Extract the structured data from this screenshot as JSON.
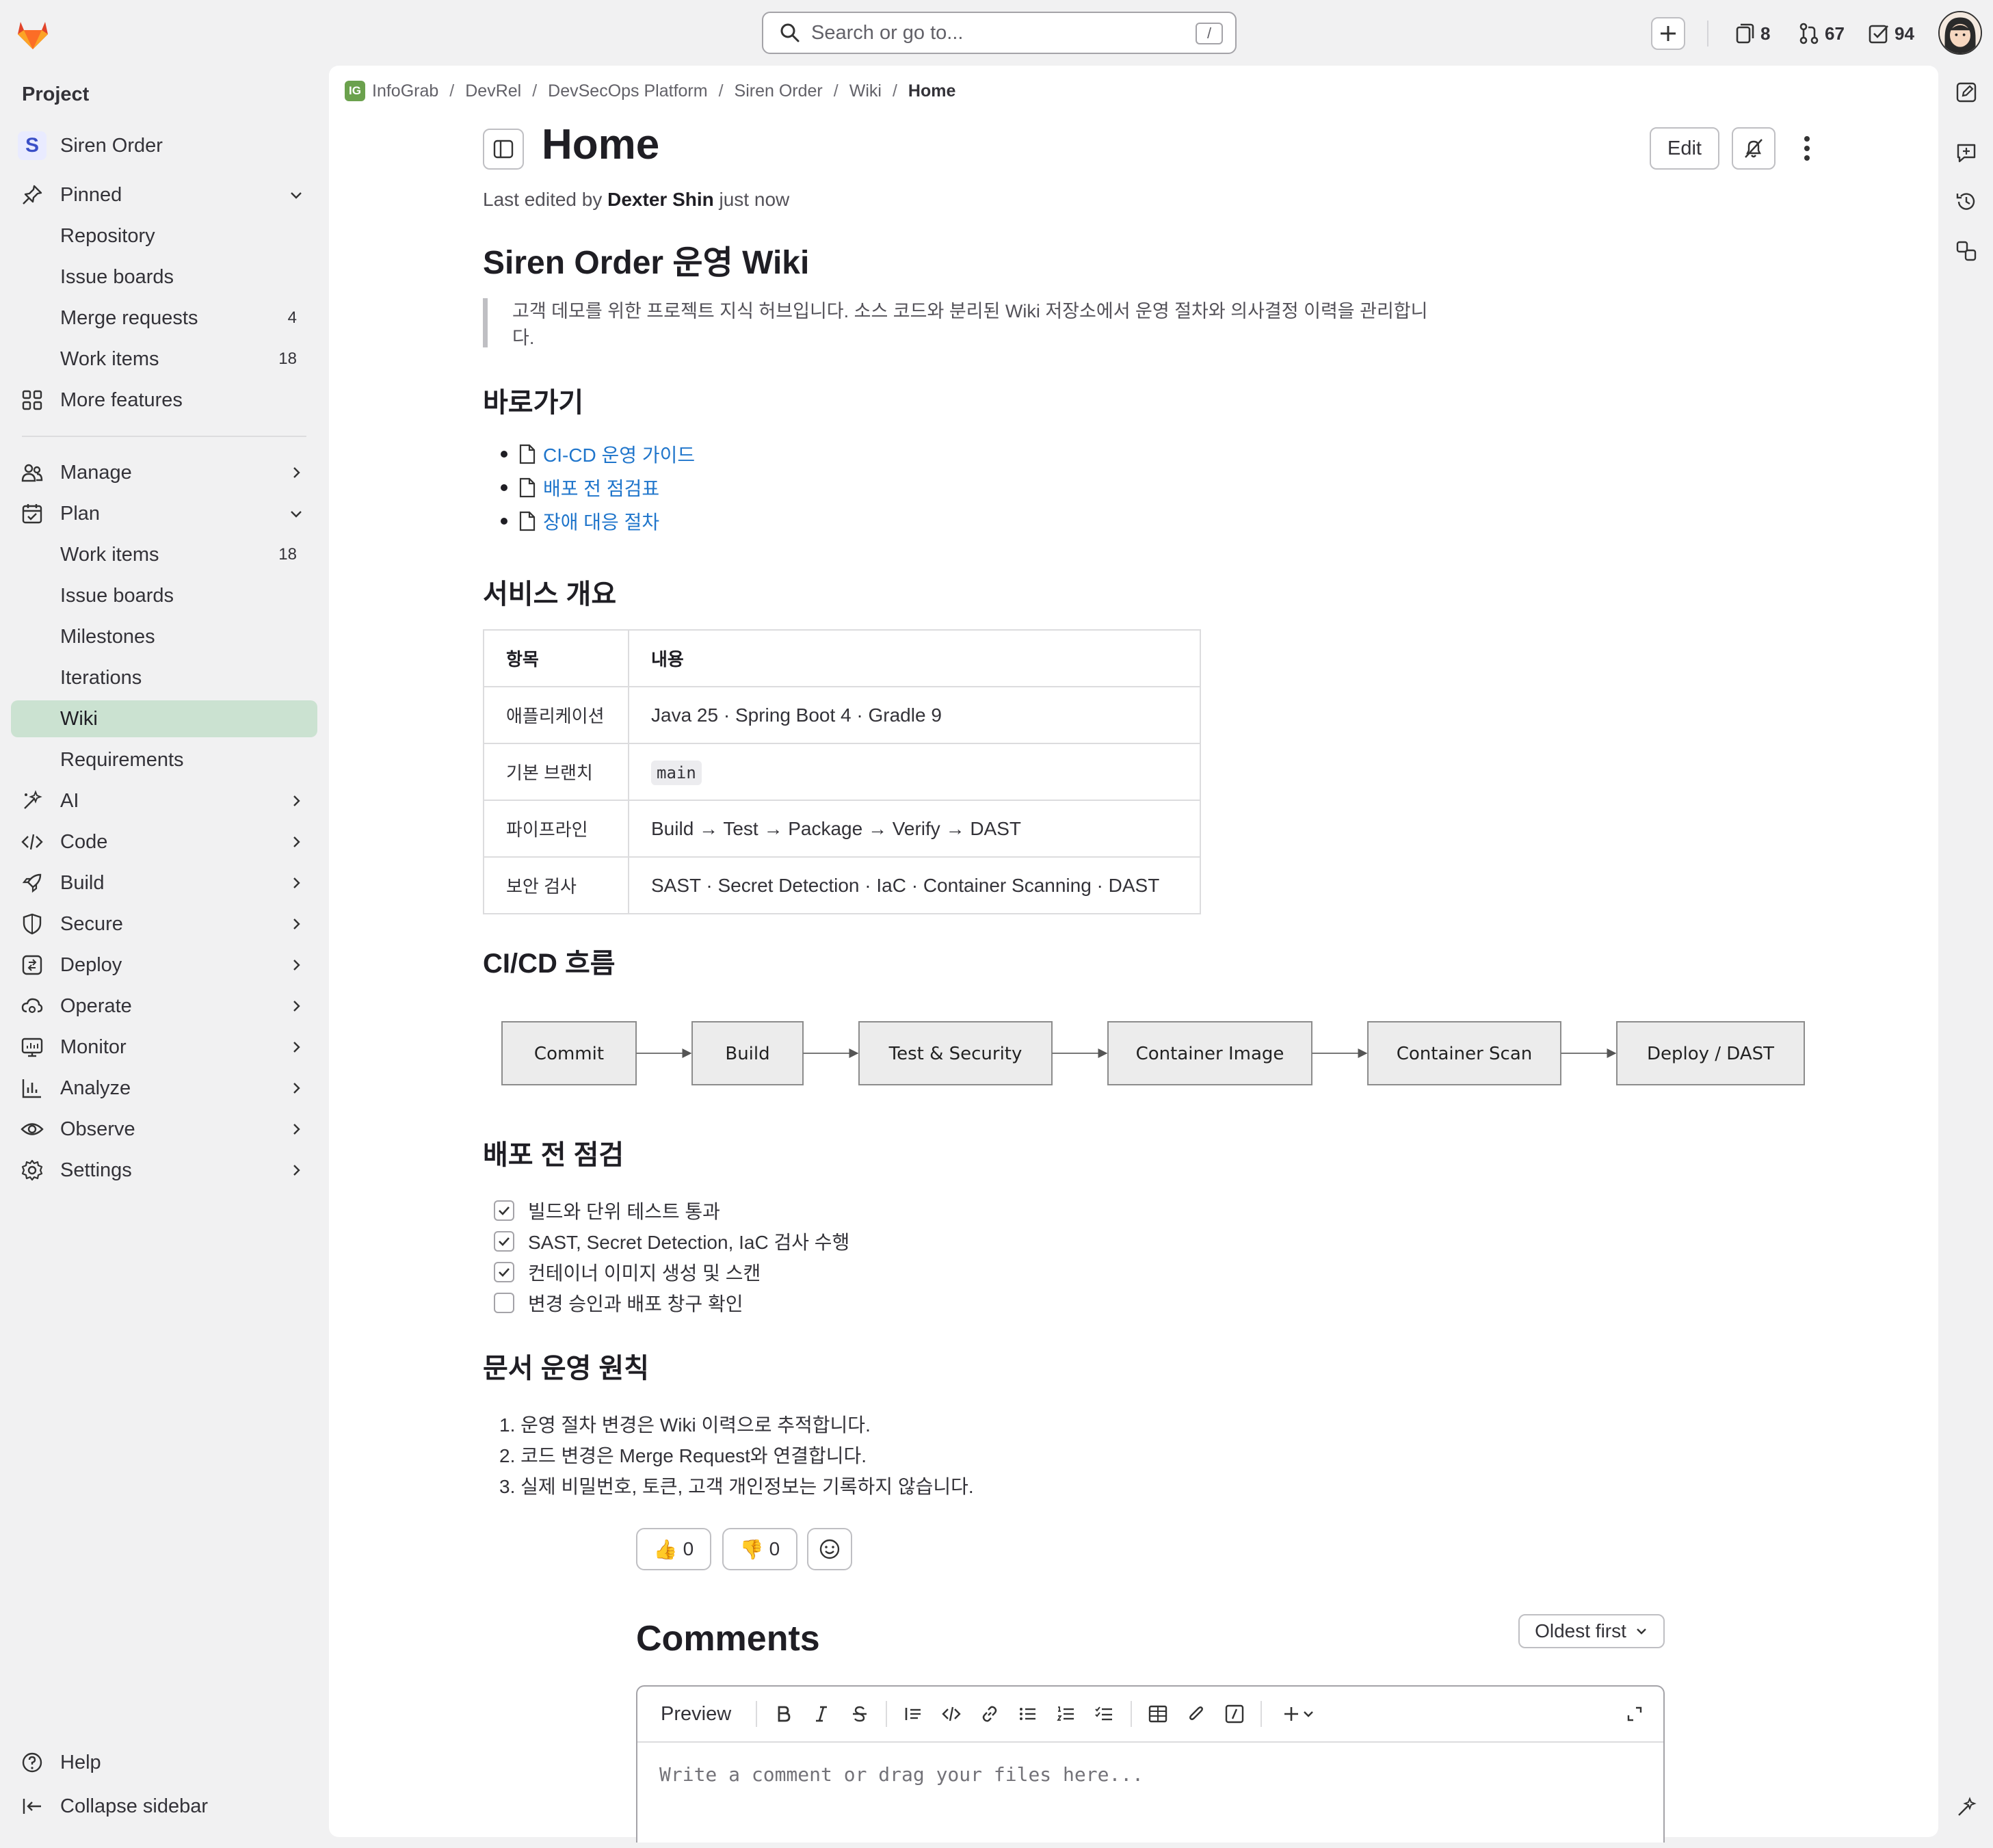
{
  "search": {
    "placeholder": "Search or go to...",
    "shortcut": "/"
  },
  "top_counters": {
    "issues": "8",
    "merge_requests": "67",
    "todos": "94"
  },
  "sidebar": {
    "heading": "Project",
    "project": {
      "badge": "S",
      "name": "Siren Order"
    },
    "pinned": {
      "label": "Pinned",
      "items": [
        {
          "label": "Repository",
          "count": ""
        },
        {
          "label": "Issue boards",
          "count": ""
        },
        {
          "label": "Merge requests",
          "count": "4"
        },
        {
          "label": "Work items",
          "count": "18"
        }
      ]
    },
    "more_features": "More features",
    "manage": "Manage",
    "plan": {
      "label": "Plan",
      "items": [
        {
          "label": "Work items",
          "count": "18"
        },
        {
          "label": "Issue boards",
          "count": ""
        },
        {
          "label": "Milestones",
          "count": ""
        },
        {
          "label": "Iterations",
          "count": ""
        },
        {
          "label": "Wiki",
          "count": ""
        },
        {
          "label": "Requirements",
          "count": ""
        }
      ]
    },
    "groups": [
      "AI",
      "Code",
      "Build",
      "Secure",
      "Deploy",
      "Operate",
      "Monitor",
      "Analyze",
      "Observe",
      "Settings"
    ],
    "help": "Help",
    "collapse": "Collapse sidebar"
  },
  "breadcrumbs": [
    "InfoGrab",
    "DevRel",
    "DevSecOps Platform",
    "Siren Order",
    "Wiki",
    "Home"
  ],
  "breadcrumb_badge": "IG",
  "page": {
    "title": "Home",
    "edit_label": "Edit",
    "last_edited_prefix": "Last edited by",
    "last_edited_author": "Dexter Shin",
    "last_edited_suffix": "just now"
  },
  "wiki": {
    "h1": "Siren Order 운영 Wiki",
    "quote": "고객 데모를 위한 프로젝트 지식 허브입니다. 소스 코드와 분리된 Wiki 저장소에서 운영 절차와 의사결정 이력을 관리합니다.",
    "shortcuts_heading": "바로가기",
    "shortcuts": [
      "CI-CD 운영 가이드",
      "배포 전 점검표",
      "장애 대응 절차"
    ],
    "service_heading": "서비스 개요",
    "table": {
      "headers": [
        "항목",
        "내용"
      ],
      "rows": [
        [
          "애플리케이션",
          "Java 25 · Spring Boot 4 · Gradle 9"
        ],
        [
          "기본 브랜치",
          "main"
        ],
        [
          "파이프라인",
          "Build → Test → Package → Verify → DAST"
        ],
        [
          "보안 검사",
          "SAST · Secret Detection · IaC · Container Scanning · DAST"
        ]
      ]
    },
    "cicd_heading": "CI/CD 흐름",
    "flow": [
      "Commit",
      "Build",
      "Test & Security",
      "Container Image",
      "Container Scan",
      "Deploy / DAST"
    ],
    "check_heading": "배포 전 점검",
    "checklist": [
      {
        "label": "빌드와 단위 테스트 통과",
        "checked": true
      },
      {
        "label": "SAST, Secret Detection, IaC 검사 수행",
        "checked": true
      },
      {
        "label": "컨테이너 이미지 생성 및 스캔",
        "checked": true
      },
      {
        "label": "변경 승인과 배포 창구 확인",
        "checked": false
      }
    ],
    "docs_heading": "문서 운영 원칙",
    "principles": [
      "운영 절차 변경은 Wiki 이력으로 추적합니다.",
      "코드 변경은 Merge Request와 연결합니다.",
      "실제 비밀번호, 토큰, 고객 개인정보는 기록하지 않습니다."
    ]
  },
  "reactions": {
    "thumbs_up": "0",
    "thumbs_down": "0"
  },
  "comments": {
    "title": "Comments",
    "sort_label": "Oldest first",
    "preview_label": "Preview",
    "placeholder": "Write a comment or drag your files here..."
  },
  "colors": {
    "link": "#1f75cb",
    "active_nav": "#cbe2d1",
    "brand_orange": "#e24329"
  }
}
